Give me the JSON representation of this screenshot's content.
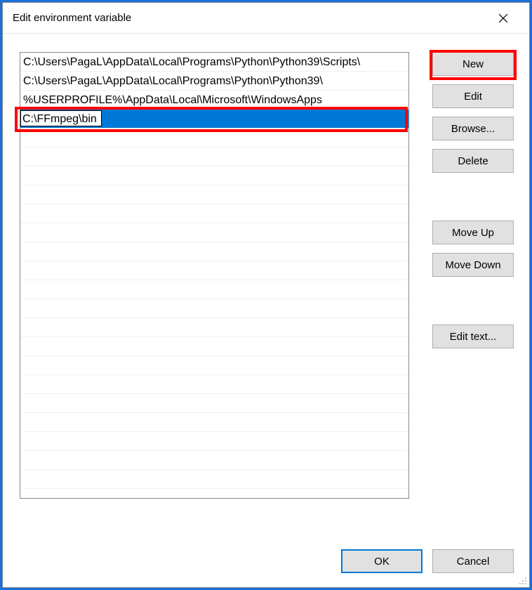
{
  "title": "Edit environment variable",
  "list": {
    "items": [
      "C:\\Users\\PagaL\\AppData\\Local\\Programs\\Python\\Python39\\Scripts\\",
      "C:\\Users\\PagaL\\AppData\\Local\\Programs\\Python\\Python39\\",
      "%USERPROFILE%\\AppData\\Local\\Microsoft\\WindowsApps"
    ],
    "editing_value": "C:\\FFmpeg\\bin",
    "editing_index": 3
  },
  "buttons": {
    "new": "New",
    "edit": "Edit",
    "browse": "Browse...",
    "delete": "Delete",
    "moveup": "Move Up",
    "movedown": "Move Down",
    "edittext": "Edit text..."
  },
  "footer": {
    "ok": "OK",
    "cancel": "Cancel"
  }
}
